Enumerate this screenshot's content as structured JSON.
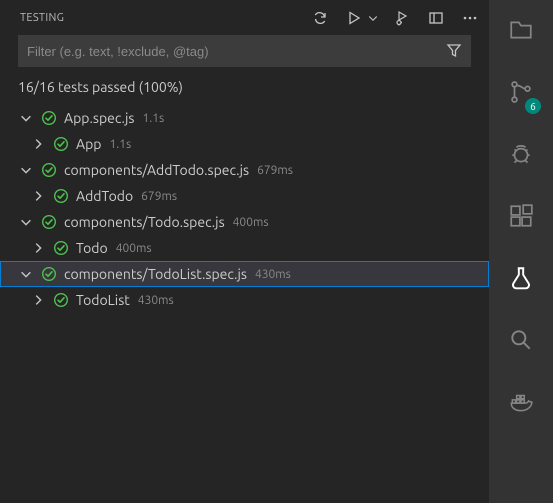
{
  "header": {
    "title": "TESTING"
  },
  "filter": {
    "placeholder": "Filter (e.g. text, !exclude, @tag)",
    "value": ""
  },
  "summary": "16/16 tests passed (100%)",
  "tests": [
    {
      "depth": 0,
      "expanded": true,
      "status": "pass",
      "label": "App.spec.js",
      "duration": "1.1s",
      "selected": false
    },
    {
      "depth": 1,
      "expanded": false,
      "status": "pass",
      "label": "App",
      "duration": "1.1s",
      "selected": false
    },
    {
      "depth": 0,
      "expanded": true,
      "status": "pass",
      "label": "components/AddTodo.spec.js",
      "duration": "679ms",
      "selected": false
    },
    {
      "depth": 1,
      "expanded": false,
      "status": "pass",
      "label": "AddTodo",
      "duration": "679ms",
      "selected": false
    },
    {
      "depth": 0,
      "expanded": true,
      "status": "pass",
      "label": "components/Todo.spec.js",
      "duration": "400ms",
      "selected": false
    },
    {
      "depth": 1,
      "expanded": false,
      "status": "pass",
      "label": "Todo",
      "duration": "400ms",
      "selected": false
    },
    {
      "depth": 0,
      "expanded": true,
      "status": "pass",
      "label": "components/TodoList.spec.js",
      "duration": "430ms",
      "selected": true
    },
    {
      "depth": 1,
      "expanded": false,
      "status": "pass",
      "label": "TodoList",
      "duration": "430ms",
      "selected": false
    }
  ],
  "activity": {
    "source_control_badge": "6"
  }
}
